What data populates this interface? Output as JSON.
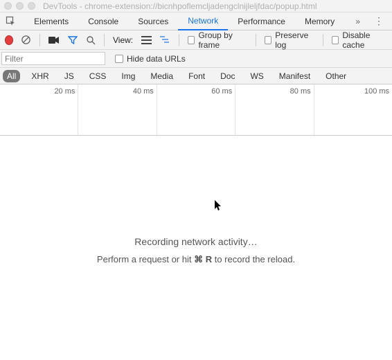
{
  "window": {
    "title": "DevTools - chrome-extension://bicnhpoflemcljadengclnijleljfdac/popup.html"
  },
  "tabs": {
    "items": [
      "Elements",
      "Console",
      "Sources",
      "Network",
      "Performance",
      "Memory"
    ],
    "active": "Network",
    "overflow_glyph": "»",
    "menu_glyph": "⋮"
  },
  "toolbar": {
    "view_label": "View:",
    "group_by_frame": "Group by frame",
    "preserve_log": "Preserve log",
    "disable_cache": "Disable cache"
  },
  "filter": {
    "placeholder": "Filter",
    "hide_data_urls": "Hide data URLs"
  },
  "types": {
    "items": [
      "All",
      "XHR",
      "JS",
      "CSS",
      "Img",
      "Media",
      "Font",
      "Doc",
      "WS",
      "Manifest",
      "Other"
    ],
    "active": "All"
  },
  "timeline": {
    "ticks": [
      "20 ms",
      "40 ms",
      "60 ms",
      "80 ms",
      "100 ms"
    ]
  },
  "empty": {
    "line1": "Recording network activity…",
    "line2_pre": "Perform a request or hit ",
    "shortcut": "⌘ R",
    "line2_post": " to record the reload."
  }
}
